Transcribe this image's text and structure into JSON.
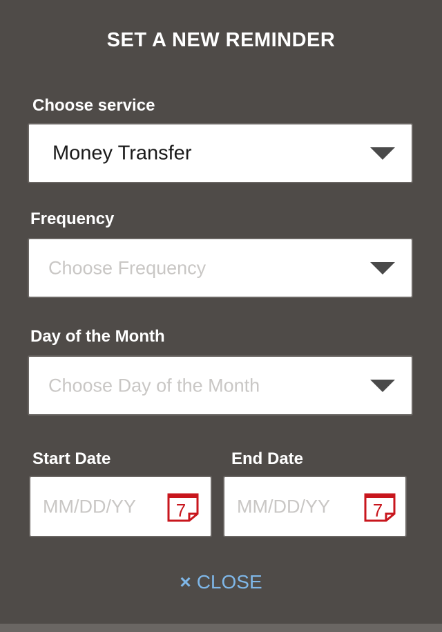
{
  "title": "SET A NEW REMINDER",
  "service": {
    "label": "Choose service",
    "value": "Money Transfer"
  },
  "frequency": {
    "label": "Frequency",
    "placeholder": "Choose Frequency"
  },
  "day_of_month": {
    "label": "Day of the Month",
    "placeholder": "Choose Day of the Month"
  },
  "start_date": {
    "label": "Start Date",
    "placeholder": "MM/DD/YY",
    "calendar_icon_number": "7"
  },
  "end_date": {
    "label": "End Date",
    "placeholder": "MM/DD/YY",
    "calendar_icon_number": "7"
  },
  "close": {
    "icon": "×",
    "label": "CLOSE"
  },
  "colors": {
    "background": "#4f4b48",
    "close_link": "#7fb7e8",
    "calendar_icon": "#c8161d"
  }
}
